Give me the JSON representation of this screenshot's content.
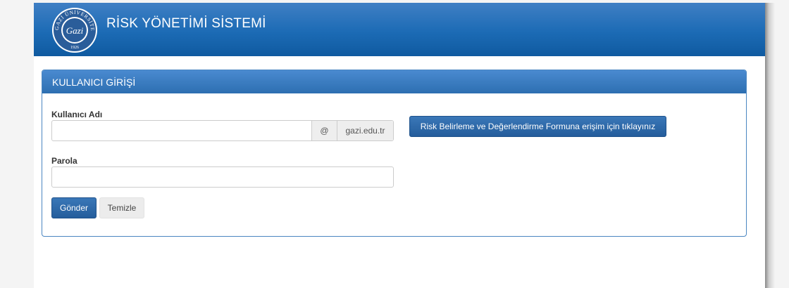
{
  "header": {
    "title": "RİSK YÖNETİMİ SİSTEMİ",
    "logo": {
      "ring_text": "GAZİ ÜNİVERSİTESİ",
      "script_text": "Gazi",
      "year": "1926"
    }
  },
  "panel": {
    "title": "KULLANICI GİRİŞİ",
    "username": {
      "label": "Kullanıcı Adı",
      "value": "",
      "at_symbol": "@",
      "domain": "gazi.edu.tr"
    },
    "password": {
      "label": "Parola",
      "value": ""
    },
    "submit_label": "Gönder",
    "clear_label": "Temizle",
    "risk_form_link": "Risk Belirleme ve Değerlendirme Formuna erişim için tıklayınız"
  },
  "colors": {
    "header_blue": "#1c6bb5",
    "panel_border": "#4a86c1",
    "primary_button": "#245d9c"
  }
}
